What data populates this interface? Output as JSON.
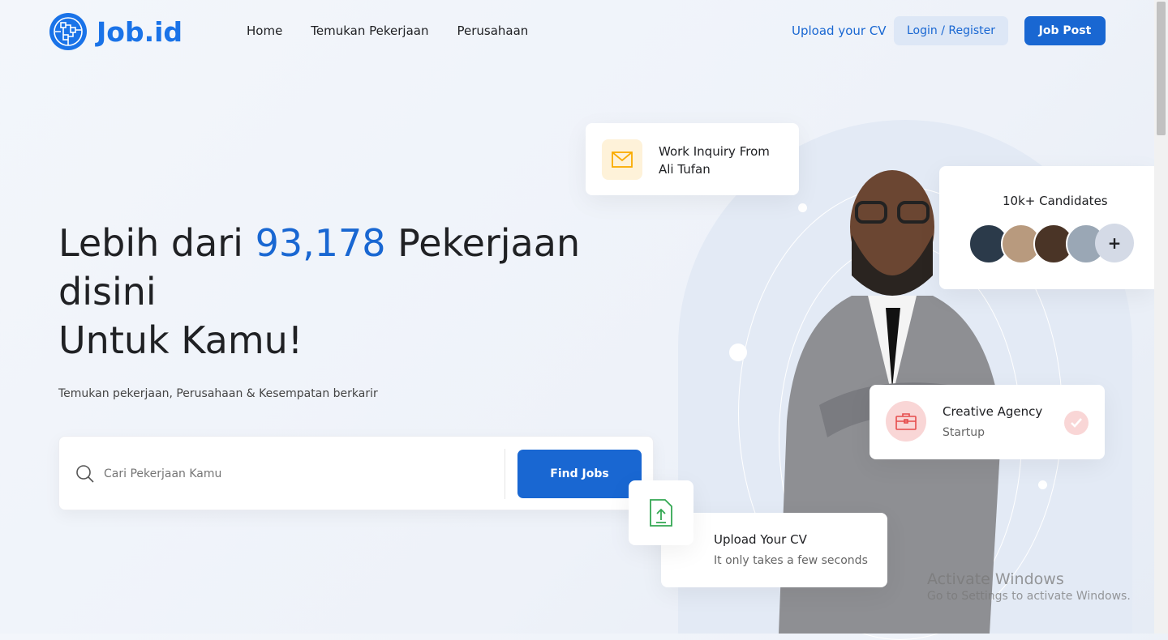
{
  "brand": {
    "name": "Job.id",
    "icon": "network-globe-icon",
    "color": "#1967d2"
  },
  "nav": {
    "items": [
      "Home",
      "Temukan Pekerjaan",
      "Perusahaan"
    ],
    "upload_cv": "Upload your CV",
    "login": "Login / Register",
    "job_post": "Job Post"
  },
  "hero": {
    "title_prefix": "Lebih dari ",
    "count": "93,178",
    "title_suffix": " Pekerjaan disini",
    "title_line2": "Untuk Kamu!",
    "subtitle": "Temukan pekerjaan, Perusahaan & Kesempatan berkarir"
  },
  "search": {
    "placeholder": "Cari Pekerjaan Kamu",
    "button": "Find Jobs"
  },
  "cards": {
    "inquiry": {
      "line1": "Work Inquiry From",
      "line2": "Ali Tufan",
      "icon": "envelope-icon"
    },
    "candidates": {
      "title": "10k+ Candidates",
      "more": "+"
    },
    "agency": {
      "title": "Creative Agency",
      "subtitle": "Startup",
      "icon": "briefcase-icon"
    },
    "upload": {
      "title": "Upload Your CV",
      "subtitle": "It only takes a few seconds",
      "icon": "file-upload-icon"
    }
  },
  "watermark": {
    "title": "Activate Windows",
    "subtitle": "Go to Settings to activate Windows."
  }
}
